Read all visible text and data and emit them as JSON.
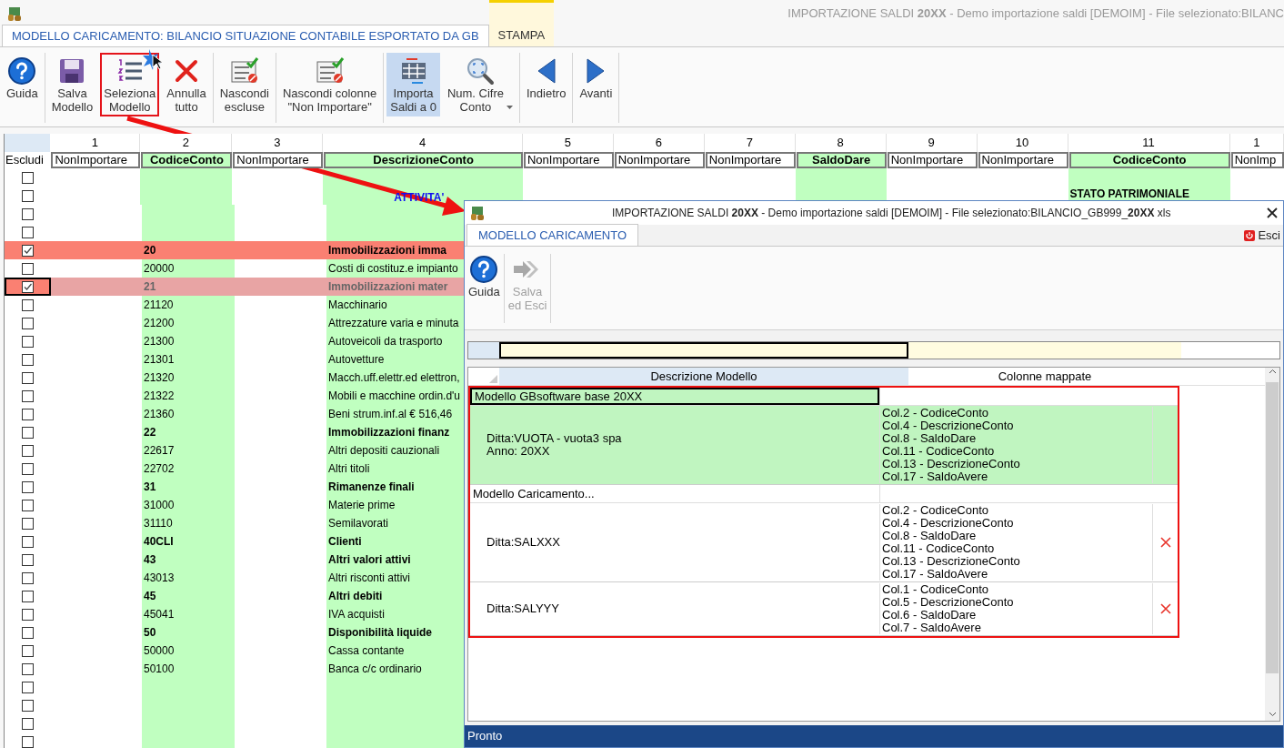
{
  "window": {
    "title": "IMPORTAZIONE SALDI  **20XX** - Demo importazione saldi [DEMOIM] - File selezionato:BILANC"
  },
  "tabs": [
    {
      "label": "MODELLO CARICAMENTO: BILANCIO SITUAZIONE CONTABILE ESPORTATO DA GB",
      "selected": true,
      "contextual": false
    },
    {
      "label": "STAMPA",
      "selected": false,
      "contextual": true
    }
  ],
  "toolbar": [
    [
      {
        "label": "Guida",
        "pressed": false,
        "highlighted": false,
        "dropdown": false
      }
    ],
    [
      {
        "label": "Salva\nModello",
        "pressed": false,
        "highlighted": false,
        "dropdown": false
      },
      {
        "label": "Seleziona\nModello",
        "pressed": false,
        "highlighted": true,
        "dropdown": false
      },
      {
        "label": "Annulla\ntutto",
        "pressed": false,
        "highlighted": false,
        "dropdown": false
      }
    ],
    [
      {
        "label": "Nascondi\nescluse",
        "pressed": false,
        "highlighted": false,
        "dropdown": false
      }
    ],
    [
      {
        "label": "Nascondi colonne\n\"Non Importare\"",
        "pressed": false,
        "highlighted": false,
        "dropdown": false
      }
    ],
    [
      {
        "label": "Importa\nSaldi a 0",
        "pressed": true,
        "highlighted": false,
        "dropdown": false
      },
      {
        "label": "Num. Cifre\nConto",
        "pressed": false,
        "highlighted": false,
        "dropdown": true
      }
    ],
    [
      {
        "label": "Indietro",
        "pressed": false,
        "highlighted": false,
        "dropdown": false
      }
    ],
    [
      {
        "label": "Avanti",
        "pressed": false,
        "highlighted": false,
        "dropdown": false
      }
    ]
  ],
  "grid": {
    "exclude_header": "Escludi",
    "columns": [
      {
        "number": "1",
        "field": "NonImportare",
        "mapped": false
      },
      {
        "number": "2",
        "field": "CodiceConto",
        "mapped": true
      },
      {
        "number": "3",
        "field": "NonImportare",
        "mapped": false
      },
      {
        "number": "4",
        "field": "DescrizioneConto",
        "mapped": true
      },
      {
        "number": "5",
        "field": "NonImportare",
        "mapped": false
      },
      {
        "number": "6",
        "field": "NonImportare",
        "mapped": false
      },
      {
        "number": "7",
        "field": "NonImportare",
        "mapped": false
      },
      {
        "number": "8",
        "field": "SaldoDare",
        "mapped": true
      },
      {
        "number": "9",
        "field": "NonImportare",
        "mapped": false
      },
      {
        "number": "10",
        "field": "NonImportare",
        "mapped": false
      },
      {
        "number": "11",
        "field": "CodiceConto",
        "mapped": true
      },
      {
        "number": "1",
        "field": "NonImp",
        "mapped": false
      }
    ],
    "rows": [
      {
        "kind": "blank",
        "excluded": false,
        "selected": false
      },
      {
        "kind": "heading",
        "excluded": false,
        "selected": false,
        "description": "ATTIVITA'",
        "section": "STATO PATRIMONIALE"
      },
      {
        "kind": "blank",
        "excluded": false,
        "selected": false
      },
      {
        "kind": "blank",
        "excluded": false,
        "selected": false
      },
      {
        "kind": "group",
        "excluded": true,
        "selected": false,
        "code": "20",
        "description": "Immobilizzazioni imma"
      },
      {
        "kind": "account",
        "excluded": false,
        "selected": false,
        "code": "20000",
        "description": "Costi di costituz.e impianto"
      },
      {
        "kind": "group",
        "excluded": true,
        "selected": true,
        "code": "21",
        "description": "Immobilizzazioni mater"
      },
      {
        "kind": "account",
        "excluded": false,
        "selected": false,
        "code": "21120",
        "description": "Macchinario"
      },
      {
        "kind": "account",
        "excluded": false,
        "selected": false,
        "code": "21200",
        "description": "Attrezzature varia e minuta"
      },
      {
        "kind": "account",
        "excluded": false,
        "selected": false,
        "code": "21300",
        "description": "Autoveicoli da trasporto"
      },
      {
        "kind": "account",
        "excluded": false,
        "selected": false,
        "code": "21301",
        "description": "Autovetture"
      },
      {
        "kind": "account",
        "excluded": false,
        "selected": false,
        "code": "21320",
        "description": "Macch.uff.elettr.ed elettron,"
      },
      {
        "kind": "account",
        "excluded": false,
        "selected": false,
        "code": "21322",
        "description": "Mobili e macchine ordin.d'u"
      },
      {
        "kind": "account",
        "excluded": false,
        "selected": false,
        "code": "21360",
        "description": "Beni strum.inf.al € 516,46"
      },
      {
        "kind": "group",
        "excluded": false,
        "selected": false,
        "code": "22",
        "description": "Immobilizzazioni finanz"
      },
      {
        "kind": "account",
        "excluded": false,
        "selected": false,
        "code": "22617",
        "description": "Altri depositi cauzionali"
      },
      {
        "kind": "account",
        "excluded": false,
        "selected": false,
        "code": "22702",
        "description": "Altri titoli"
      },
      {
        "kind": "group",
        "excluded": false,
        "selected": false,
        "code": "31",
        "description": "Rimanenze finali"
      },
      {
        "kind": "account",
        "excluded": false,
        "selected": false,
        "code": "31000",
        "description": "Materie prime"
      },
      {
        "kind": "account",
        "excluded": false,
        "selected": false,
        "code": "31110",
        "description": "Semilavorati"
      },
      {
        "kind": "group",
        "excluded": false,
        "selected": false,
        "code": "40CLI",
        "description": "Clienti"
      },
      {
        "kind": "group",
        "excluded": false,
        "selected": false,
        "code": "43",
        "description": "Altri valori attivi"
      },
      {
        "kind": "account",
        "excluded": false,
        "selected": false,
        "code": "43013",
        "description": "Altri risconti attivi"
      },
      {
        "kind": "group",
        "excluded": false,
        "selected": false,
        "code": "45",
        "description": "Altri debiti"
      },
      {
        "kind": "account",
        "excluded": false,
        "selected": false,
        "code": "45041",
        "description": "IVA acquisti"
      },
      {
        "kind": "group",
        "excluded": false,
        "selected": false,
        "code": "50",
        "description": "Disponibilità liquide"
      },
      {
        "kind": "account",
        "excluded": false,
        "selected": false,
        "code": "50000",
        "description": "Cassa contante"
      },
      {
        "kind": "account",
        "excluded": false,
        "selected": false,
        "code": "50100",
        "description": "Banca c/c ordinario"
      },
      {
        "kind": "blank",
        "excluded": false,
        "selected": false
      },
      {
        "kind": "blank",
        "excluded": false,
        "selected": false
      },
      {
        "kind": "blank",
        "excluded": false,
        "selected": false
      },
      {
        "kind": "blank",
        "excluded": false,
        "selected": false
      }
    ]
  },
  "dialog": {
    "title": "IMPORTAZIONE SALDI **20XX** - Demo importazione saldi [DEMOIM] - File selezionato:BILANCIO_GB999_**20XX** xls",
    "tabs": [
      {
        "label": "MODELLO CARICAMENTO",
        "selected": true
      }
    ],
    "exit_button": "Esci",
    "toolbar": [
      {
        "label": "Guida",
        "disabled": false
      },
      {
        "label": "Salva\ned Esci",
        "disabled": true
      }
    ],
    "table": {
      "columns": [
        "Descrizione Modello",
        "Colonne mappate"
      ],
      "annotated": true,
      "groups": [
        {
          "label": "Modello GBsoftware base 20XX",
          "selected": true,
          "items": [
            {
              "lines": [
                "Ditta:VUOTA - vuota3 spa",
                "Anno: 20XX"
              ],
              "selected": true,
              "deletable": false,
              "mapped": [
                "Col.2 - CodiceConto",
                "Col.4 - DescrizioneConto",
                "Col.8 - SaldoDare",
                "Col.11 - CodiceConto",
                "Col.13 - DescrizioneConto",
                "Col.17 - SaldoAvere"
              ]
            }
          ]
        },
        {
          "label": "Modello Caricamento...",
          "selected": false,
          "items": [
            {
              "lines": [
                "Ditta:SALXXX"
              ],
              "selected": false,
              "deletable": true,
              "mapped": [
                "Col.2 - CodiceConto",
                "Col.4 - DescrizioneConto",
                "Col.8 - SaldoDare",
                "Col.11 - CodiceConto",
                "Col.13 - DescrizioneConto",
                "Col.17 - SaldoAvere"
              ]
            },
            {
              "lines": [
                "Ditta:SALYYY"
              ],
              "selected": false,
              "deletable": true,
              "mapped": [
                "Col.1 - CodiceConto",
                "Col.5 - DescrizioneConto",
                "Col.6 - SaldoDare",
                "Col.7 - SaldoAvere"
              ]
            }
          ]
        }
      ]
    },
    "status": "Pronto"
  }
}
